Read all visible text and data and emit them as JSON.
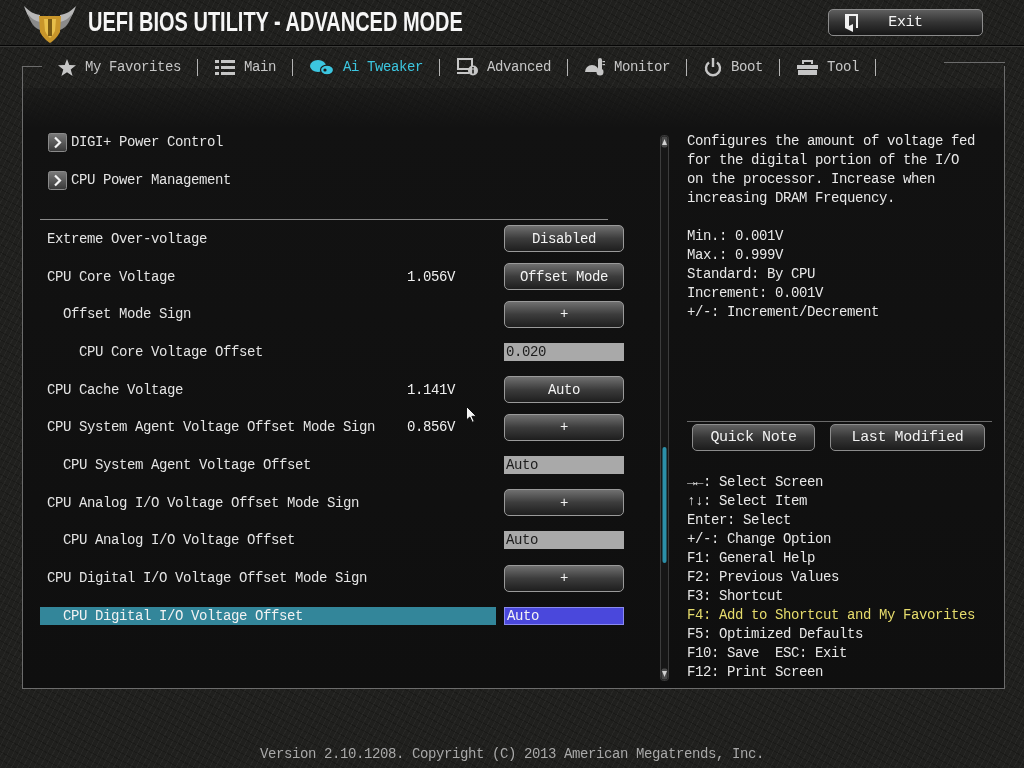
{
  "header": {
    "title": "UEFI BIOS UTILITY - ADVANCED MODE",
    "exit_button": "Exit"
  },
  "tabs": [
    {
      "label": "My Favorites",
      "selected": false
    },
    {
      "label": "Main",
      "selected": false
    },
    {
      "label": "Ai Tweaker",
      "selected": true
    },
    {
      "label": "Advanced",
      "selected": false
    },
    {
      "label": "Monitor",
      "selected": false
    },
    {
      "label": "Boot",
      "selected": false
    },
    {
      "label": "Tool",
      "selected": false
    }
  ],
  "submenus": [
    {
      "label": "DIGI+ Power Control"
    },
    {
      "label": "CPU Power Management"
    }
  ],
  "settings": [
    {
      "label": "Extreme Over-voltage",
      "control": {
        "kind": "button",
        "value": "Disabled"
      },
      "selected": false
    },
    {
      "label": "CPU Core Voltage",
      "reading": "1.056V",
      "control": {
        "kind": "button",
        "value": "Offset Mode"
      },
      "selected": false,
      "children": [
        {
          "label": "Offset Mode Sign",
          "control": {
            "kind": "button",
            "value": "+"
          },
          "selected": false,
          "children": [
            {
              "label": "CPU Core Voltage Offset",
              "control": {
                "kind": "field",
                "value": "0.020"
              },
              "selected": false
            }
          ]
        }
      ]
    },
    {
      "label": "CPU Cache Voltage",
      "reading": "1.141V",
      "control": {
        "kind": "button",
        "value": "Auto"
      },
      "selected": false
    },
    {
      "label": "CPU System Agent Voltage Offset Mode Sign",
      "reading": "0.856V",
      "control": {
        "kind": "button",
        "value": "+"
      },
      "selected": false,
      "children": [
        {
          "label": "CPU System Agent Voltage Offset",
          "control": {
            "kind": "field",
            "value": "Auto"
          },
          "selected": false
        }
      ]
    },
    {
      "label": "CPU Analog I/O Voltage Offset Mode Sign",
      "control": {
        "kind": "button",
        "value": "+"
      },
      "selected": false,
      "children": [
        {
          "label": "CPU Analog I/O Voltage Offset",
          "control": {
            "kind": "field",
            "value": "Auto"
          },
          "selected": false
        }
      ]
    },
    {
      "label": "CPU Digital I/O Voltage Offset Mode Sign",
      "control": {
        "kind": "button",
        "value": "+"
      },
      "selected": false,
      "children": [
        {
          "label": "CPU Digital I/O Voltage Offset",
          "control": {
            "kind": "field",
            "value": "Auto"
          },
          "selected": true
        }
      ]
    }
  ],
  "help": {
    "description": "Configures the amount of voltage fed for the digital portion of the I/O on the processor. Increase when increasing DRAM Frequency.",
    "details": [
      "Min.: 0.001V",
      "Max.: 0.999V",
      "Standard: By CPU",
      "Increment: 0.001V",
      "+/-: Increment/Decrement"
    ]
  },
  "help_buttons": [
    "Quick Note",
    "Last Modified"
  ],
  "key_help": [
    {
      "text": "→←: Select Screen",
      "highlighted": false
    },
    {
      "text": "↑↓: Select Item",
      "highlighted": false
    },
    {
      "text": "Enter: Select",
      "highlighted": false
    },
    {
      "text": "+/-: Change Option",
      "highlighted": false
    },
    {
      "text": "F1: General Help",
      "highlighted": false
    },
    {
      "text": "F2: Previous Values",
      "highlighted": false
    },
    {
      "text": "F3: Shortcut",
      "highlighted": false
    },
    {
      "text": "F4: Add to Shortcut and My Favorites",
      "highlighted": true
    },
    {
      "text": "F5: Optimized Defaults",
      "highlighted": false
    },
    {
      "text": "F10: Save  ESC: Exit",
      "highlighted": false
    },
    {
      "text": "F12: Print Screen",
      "highlighted": false
    }
  ],
  "footer": "Version 2.10.1208. Copyright (C) 2013 American Megatrends, Inc."
}
